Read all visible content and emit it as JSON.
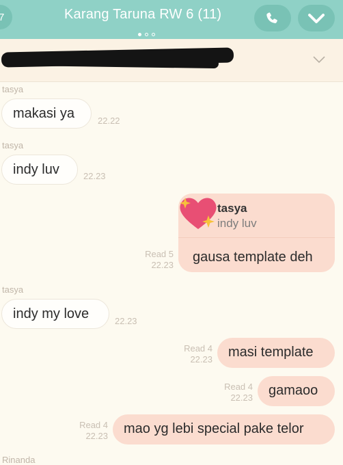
{
  "header": {
    "back_label": "7",
    "title": "Karang Taruna RW 6 (11)",
    "accent_color": "#8fd1c6",
    "icons": [
      "phone-icon",
      "chevron-down-icon"
    ]
  },
  "messages": [
    {
      "sender": "tasya",
      "text": "makasi ya",
      "time": "22.22"
    },
    {
      "sender": "tasya",
      "text": "indy luv",
      "time": "22.23"
    },
    {
      "reply_to": {
        "sender": "tasya",
        "text": "indy luv"
      },
      "text": "gausa template deh",
      "read": "Read 5",
      "time": "22.23"
    },
    {
      "sender": "tasya",
      "text": "indy my love",
      "time": "22.23"
    },
    {
      "text": "masi template",
      "read": "Read 4",
      "time": "22.23"
    },
    {
      "text": "gamaoo",
      "read": "Read 4",
      "time": "22.23"
    },
    {
      "text": "mao yg lebi special pake telor",
      "read": "Read 4",
      "time": "22.23"
    },
    {
      "sender": "Rinanda"
    }
  ]
}
